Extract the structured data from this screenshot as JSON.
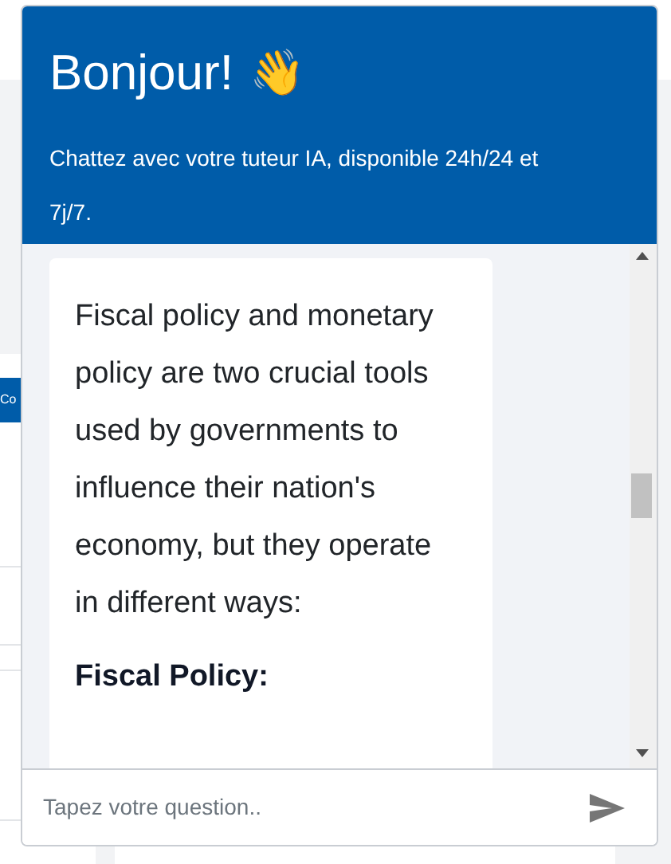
{
  "background_page": {
    "button_fragment": "Co"
  },
  "chat": {
    "title": "Bonjour!",
    "title_emoji": "👋",
    "subtitle": "Chattez avec votre tuteur IA, disponible 24h/24 et 7j/7.",
    "messages": [
      {
        "kind": "paragraph",
        "text": "Fiscal policy and monetary policy are two crucial tools used by governments to influence their nation's economy, but they operate in different ways:"
      },
      {
        "kind": "heading",
        "text": "Fiscal Policy:"
      }
    ],
    "input": {
      "placeholder": "Tapez votre question.."
    }
  }
}
